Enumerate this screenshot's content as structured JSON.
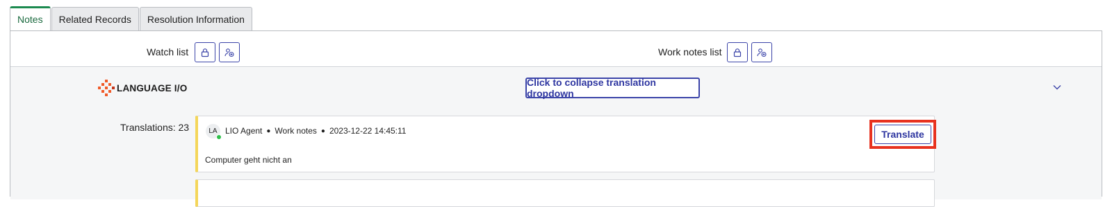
{
  "tabs": [
    {
      "label": "Notes",
      "active": true
    },
    {
      "label": "Related Records",
      "active": false
    },
    {
      "label": "Resolution Information",
      "active": false
    }
  ],
  "watch_list": {
    "label": "Watch list",
    "icons": [
      "lock-icon",
      "add-user-icon"
    ]
  },
  "work_notes_list": {
    "label": "Work notes list",
    "icons": [
      "lock-icon",
      "add-user-icon"
    ]
  },
  "language_io": {
    "logo_text": "LANGUAGE I/O",
    "collapse_button": "Click to collapse translation dropdown",
    "chevron_icon": "chevron-down-icon"
  },
  "translations": {
    "label": "Translations:",
    "count": "23"
  },
  "note_card": {
    "avatar_initials": "LA",
    "author": "LIO Agent",
    "type": "Work notes",
    "timestamp": "2023-12-22 14:45:11",
    "message": "Computer geht nicht an",
    "translate_button": "Translate"
  },
  "colors": {
    "accent": "#3a43a8",
    "active_tab": "#1b8a4f",
    "highlight": "#e8321f",
    "card_border": "#f4d65a",
    "logo": "#f05a28"
  }
}
